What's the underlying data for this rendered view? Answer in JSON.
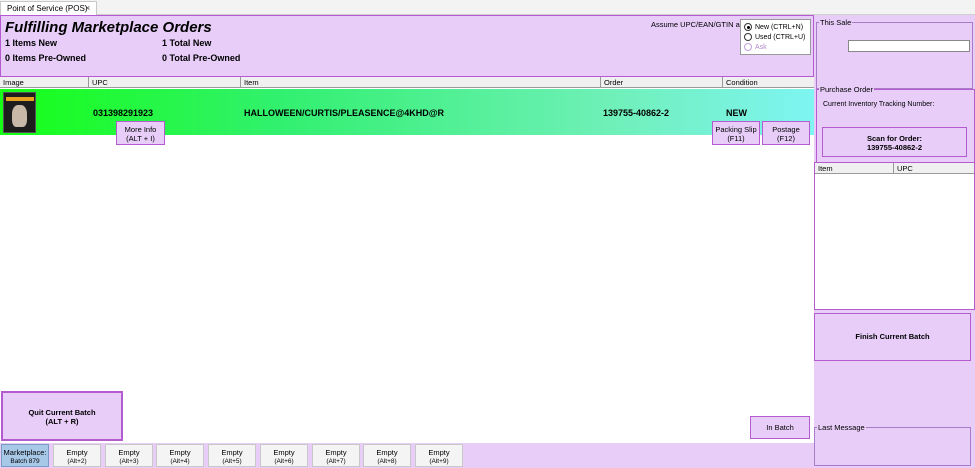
{
  "tab": {
    "title": "Point of Service (POS)",
    "close": "×"
  },
  "header": {
    "title": "Fulfilling Marketplace Orders",
    "items_new": "1 Items New",
    "items_preowned": "0 Items Pre-Owned",
    "total_new": "1 Total New",
    "total_preowned": "0 Total Pre-Owned",
    "assume_label": "Assume UPC/EAN/GTIN are:",
    "radio_new": "New (CTRL+N)",
    "radio_used": "Used (CTRL+U)",
    "radio_ask": "Ask",
    "selected": "new"
  },
  "grid": {
    "columns": [
      "Image",
      "UPC",
      "Item",
      "Order",
      "Condition"
    ],
    "row": {
      "upc": "031398291923",
      "item": "HALLOWEEN/CURTIS/PLEASENCE@4KHD@R",
      "order": "139755-40862-2",
      "condition": "NEW",
      "more_info": "More Info",
      "more_info_key": "(ALT + I)",
      "packing_slip": "Packing Slip",
      "packing_slip_key": "(F11)",
      "postage": "Postage",
      "postage_key": "(F12)"
    }
  },
  "quit": {
    "label": "Quit Current Batch",
    "key": "(ALT + R)"
  },
  "in_batch": "In Batch",
  "batches": [
    {
      "label": "Marketplace:",
      "sub": "Batch 879",
      "active": true
    },
    {
      "label": "Empty",
      "sub": "(Alt+2)"
    },
    {
      "label": "Empty",
      "sub": "(Alt+3)"
    },
    {
      "label": "Empty",
      "sub": "(Alt+4)"
    },
    {
      "label": "Empty",
      "sub": "(Alt+5)"
    },
    {
      "label": "Empty",
      "sub": "(Alt+6)"
    },
    {
      "label": "Empty",
      "sub": "(Alt+7)"
    },
    {
      "label": "Empty",
      "sub": "(Alt+8)"
    },
    {
      "label": "Empty",
      "sub": "(Alt+9)"
    }
  ],
  "right": {
    "this_sale": "This Sale",
    "sale_value": "",
    "purchase_order": "Purchase Order",
    "tracking_label": "Current Inventory Tracking Number:",
    "scan_label": "Scan for Order:",
    "scan_order": "139755-40862-2",
    "grid_columns": [
      "Item",
      "UPC"
    ],
    "finish": "Finish Current Batch",
    "last_message": "Last Message"
  },
  "colors": {
    "accent": "#b45bd0",
    "panel": "#e7cdf8",
    "row_start": "#16ff16",
    "row_end": "#7ff4f2"
  }
}
